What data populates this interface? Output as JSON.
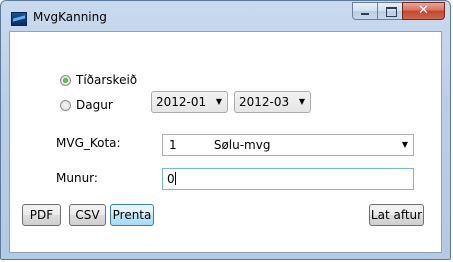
{
  "window": {
    "title": "MvgKanning",
    "close_glyph": "✕",
    "icons": {
      "app": "app-icon",
      "minimize": "minimize-icon",
      "maximize": "maximize-icon",
      "close": "close-icon"
    }
  },
  "period": {
    "options": [
      {
        "label": "Tíðarskeið",
        "checked": true
      },
      {
        "label": "Dagur",
        "checked": false
      }
    ],
    "from": "2012-01",
    "to": "2012-03"
  },
  "mvg_kota": {
    "label": "MVG_Kota:",
    "code": "1",
    "name": "Sølu-mvg"
  },
  "munur": {
    "label": "Munur:",
    "value": "0"
  },
  "buttons": {
    "pdf": "PDF",
    "csv": "CSV",
    "prenta": "Prenta",
    "close": "Lat aftur"
  },
  "colors": {
    "title_bar": "#b9cfe8",
    "close_button": "#c4452c",
    "focus_border": "#3c7fb1"
  }
}
